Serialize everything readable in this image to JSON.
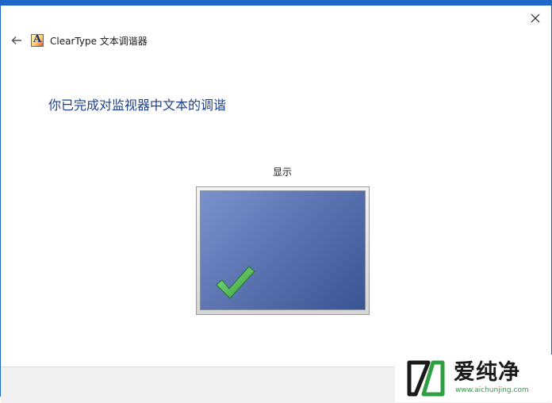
{
  "window": {
    "close_glyph": "✕",
    "accent_color": "#1f67c6"
  },
  "header": {
    "back_icon": "back-arrow-icon",
    "app_icon": "cleartype-icon",
    "app_icon_letter": "A",
    "title": "ClearType 文本调谐器"
  },
  "main": {
    "heading": "你已完成对监视器中文本的调谐",
    "monitor_label": "显示",
    "monitor_icon": "checkmark-icon",
    "check_color": "#3fb13f"
  },
  "watermark": {
    "brand": "爱纯净",
    "url": "www.aichunjing.com"
  }
}
